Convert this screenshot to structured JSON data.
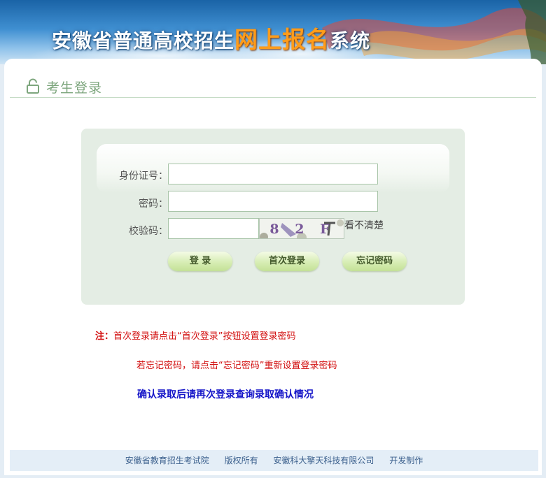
{
  "banner": {
    "title_pre": "安徽省普通高校招生",
    "title_highlight": "网上报名",
    "title_post": "系统"
  },
  "section": {
    "title": "考生登录",
    "icon": "lock-icon"
  },
  "form": {
    "id_label": "身份证号：",
    "id_value": "",
    "password_label": "密码：",
    "password_value": "",
    "captcha_label": "校验码：",
    "captcha_value": "",
    "captcha_text": "8 2 F",
    "refresh_link": "看不清楚"
  },
  "buttons": {
    "login": "登 录",
    "first_login": "首次登录",
    "forgot_password": "忘记密码"
  },
  "notes": {
    "prefix": "注：",
    "line1": "首次登录请点击“首次登录”按钮设置登录密码",
    "line2": "若忘记密码，请点击“忘记密码”重新设置登录密码",
    "line3": "确认录取后请再次登录查询录取确认情况"
  },
  "footer": {
    "org": "安徽省教育招生考试院",
    "rights": "版权所有",
    "company": "安徽科大擎天科技有限公司",
    "made": "开发制作"
  },
  "colors": {
    "accent_green": "#7da67d",
    "note_red": "#d20f0f",
    "note_blue": "#1515c8",
    "highlight_orange": "#ff9c1a"
  }
}
